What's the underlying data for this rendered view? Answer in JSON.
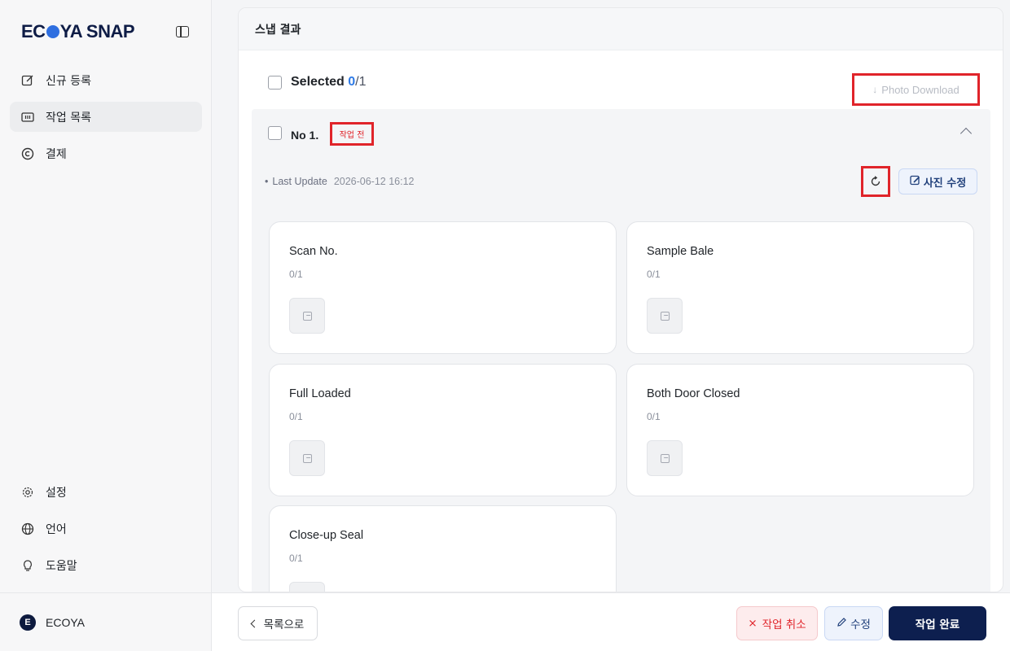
{
  "sidebar": {
    "brand": {
      "part1": "EC",
      "part2": "YA SNAP"
    },
    "nav": [
      {
        "label": "신규 등록",
        "icon": "edit-square-icon",
        "active": false
      },
      {
        "label": "작업 목록",
        "icon": "list-columns-icon",
        "active": true
      },
      {
        "label": "결제",
        "icon": "copyright-circle-icon",
        "active": false
      }
    ],
    "nav_bottom": [
      {
        "label": "설정",
        "icon": "gear-icon"
      },
      {
        "label": "언어",
        "icon": "globe-icon"
      },
      {
        "label": "도움말",
        "icon": "lightbulb-icon"
      }
    ],
    "user": {
      "avatar_letter": "E",
      "name": "ECOYA"
    }
  },
  "panel": {
    "title": "스냅 결과",
    "selected": {
      "label": "Selected",
      "count": "0",
      "total": "/1"
    },
    "photo_download": {
      "icon": "↓",
      "label": "Photo Download"
    },
    "item": {
      "number": "No 1.",
      "status": "작업 전",
      "last_update_label": "Last Update",
      "last_update_value": "2026-06-12 16:12",
      "edit_photo_label": "사진 수정",
      "cards": [
        {
          "title": "Scan No.",
          "count": "0/1"
        },
        {
          "title": "Sample Bale",
          "count": "0/1"
        },
        {
          "title": "Full Loaded",
          "count": "0/1"
        },
        {
          "title": "Both Door Closed",
          "count": "0/1"
        },
        {
          "title": "Close-up Seal",
          "count": "0/1"
        }
      ]
    }
  },
  "footer": {
    "back_label": "목록으로",
    "cancel_label": "작업 취소",
    "edit_label": "수정",
    "done_label": "작업 완료"
  },
  "colors": {
    "accent": "#2f7be6",
    "primary_dark": "#0d1f4f",
    "danger": "#e0242a",
    "highlight_box": "#e0242a"
  }
}
